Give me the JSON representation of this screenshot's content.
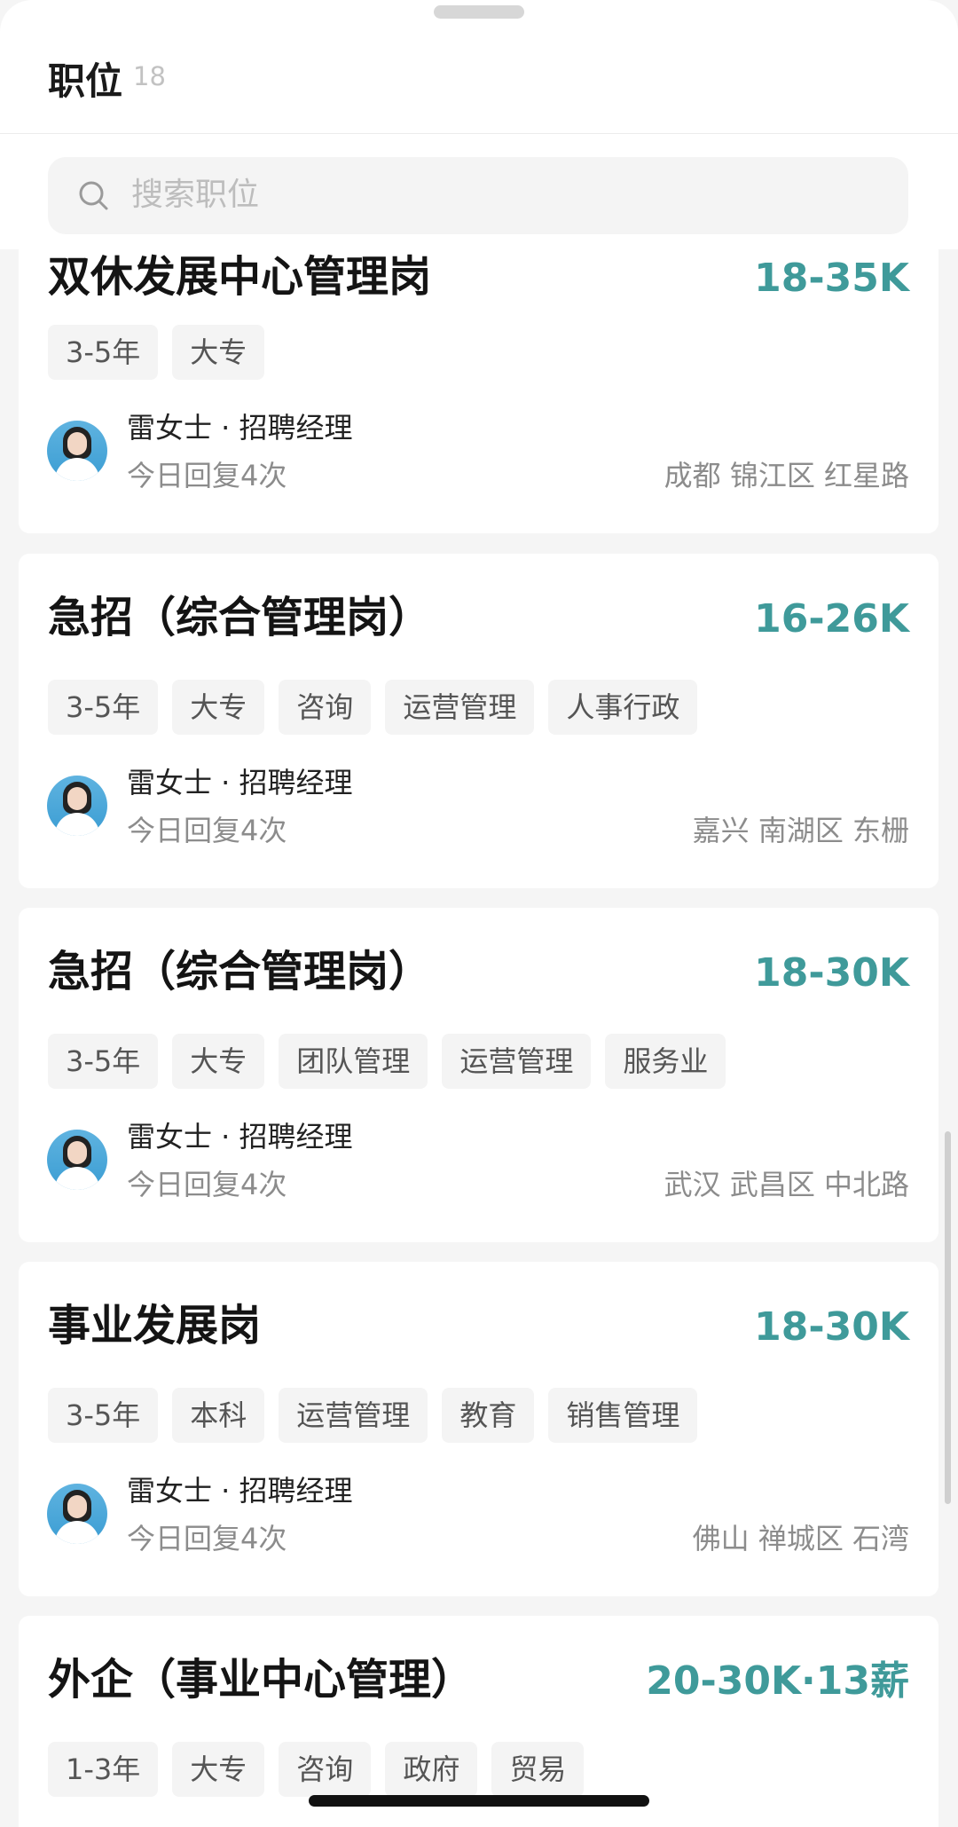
{
  "header": {
    "title": "职位",
    "count": "18"
  },
  "search": {
    "placeholder": "搜索职位",
    "icon": "search-icon"
  },
  "jobs": [
    {
      "title": "双休发展中心管理岗",
      "salary": "18-35K",
      "tags": [
        "3-5年",
        "大专"
      ],
      "recruiter": "雷女士 · 招聘经理",
      "reply": "今日回复4次",
      "location": "成都 锦江区 红星路"
    },
    {
      "title": "急招（综合管理岗）",
      "salary": "16-26K",
      "tags": [
        "3-5年",
        "大专",
        "咨询",
        "运营管理",
        "人事行政"
      ],
      "recruiter": "雷女士 · 招聘经理",
      "reply": "今日回复4次",
      "location": "嘉兴 南湖区 东栅"
    },
    {
      "title": "急招（综合管理岗）",
      "salary": "18-30K",
      "tags": [
        "3-5年",
        "大专",
        "团队管理",
        "运营管理",
        "服务业"
      ],
      "recruiter": "雷女士 · 招聘经理",
      "reply": "今日回复4次",
      "location": "武汉 武昌区 中北路"
    },
    {
      "title": "事业发展岗",
      "salary": "18-30K",
      "tags": [
        "3-5年",
        "本科",
        "运营管理",
        "教育",
        "销售管理"
      ],
      "recruiter": "雷女士 · 招聘经理",
      "reply": "今日回复4次",
      "location": "佛山 禅城区 石湾"
    },
    {
      "title": "外企（事业中心管理）",
      "salary": "20-30K·13薪",
      "tags": [
        "1-3年",
        "大专",
        "咨询",
        "政府",
        "贸易"
      ],
      "recruiter": "",
      "reply": "",
      "location": ""
    }
  ],
  "colors": {
    "salary": "#3f9a9a",
    "tag_bg": "#f4f4f4",
    "page_bg": "#f5f5f5"
  }
}
